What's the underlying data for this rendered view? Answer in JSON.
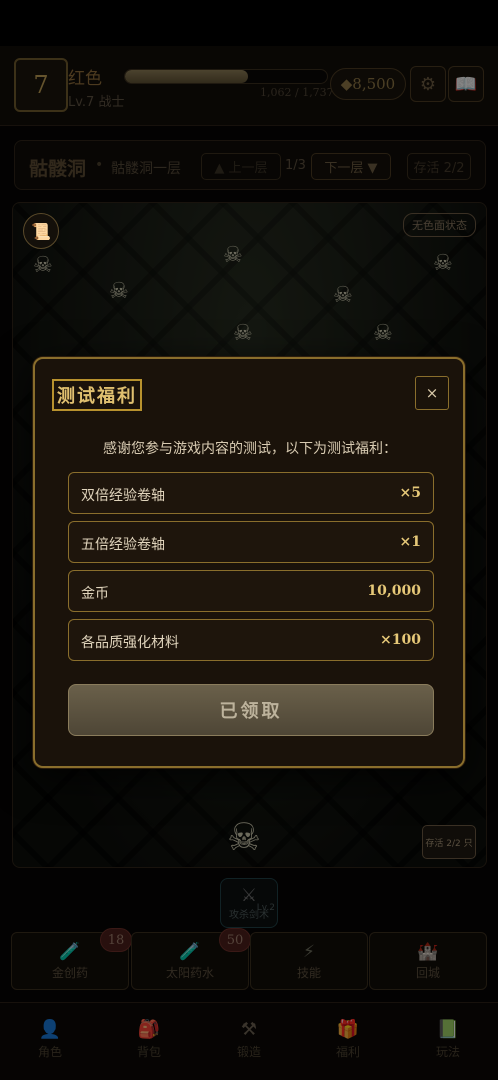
{
  "player": {
    "level": "7",
    "name": "红色",
    "subtitle": "Lv.7 战士",
    "xp_text": "1,062 / 1,737",
    "xp_fraction": 0.611,
    "gold": "◆8,500"
  },
  "header_icons": {
    "settings": "⚙",
    "book": "📖"
  },
  "location": {
    "area": "骷髅洞",
    "separator": "•",
    "floor": "骷髅洞一层",
    "prev_label": "▲ 上一层",
    "page": "1/3",
    "next_label": "下一层 ▼",
    "save_label": "存活 2/2"
  },
  "game": {
    "tag": "无色面状态",
    "save_label": "存活 2/2 只",
    "scroll_icon": "📜"
  },
  "skill": {
    "icon": "⚔",
    "label": "攻杀剑术",
    "level": "Lv.2"
  },
  "quickbar": [
    {
      "icon": "🧪",
      "label": "金创药",
      "badge": "18"
    },
    {
      "icon": "🧪",
      "label": "太阳药水",
      "badge": "50"
    },
    {
      "icon": "⚡",
      "label": "技能",
      "badge": ""
    },
    {
      "icon": "🏰",
      "label": "回城",
      "badge": ""
    }
  ],
  "nav": [
    {
      "icon": "👤",
      "label": "角色"
    },
    {
      "icon": "🎒",
      "label": "背包"
    },
    {
      "icon": "⚒",
      "label": "锻造"
    },
    {
      "icon": "🎁",
      "label": "福利"
    },
    {
      "icon": "📗",
      "label": "玩法"
    }
  ],
  "modal": {
    "title": "测试福利",
    "close": "×",
    "description": "感谢您参与游戏内容的测试，以下为测试福利：",
    "rewards": [
      {
        "name": "双倍经验卷轴",
        "qty": "×5"
      },
      {
        "name": "五倍经验卷轴",
        "qty": "×1"
      },
      {
        "name": "金币",
        "qty": "10,000"
      },
      {
        "name": "各品质强化材料",
        "qty": "×100"
      }
    ],
    "claim_label": "已领取"
  }
}
